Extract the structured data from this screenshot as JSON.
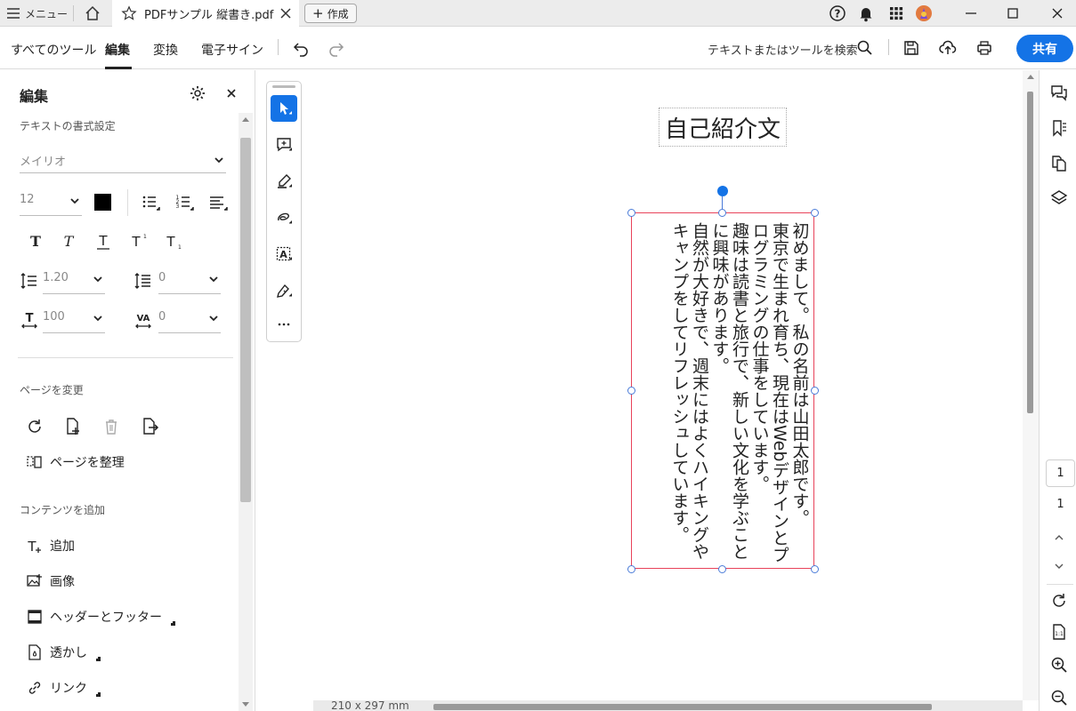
{
  "titlebar": {
    "menu_label": "メニュー",
    "tab_title": "PDFサンプル 縦書き.pdf",
    "new_label": "作成",
    "avatar_color": "#e27a3f"
  },
  "toolbar": {
    "tabs": [
      "すべてのツール",
      "編集",
      "変換",
      "電子サイン"
    ],
    "active_tab": "編集",
    "search_placeholder": "テキストまたはツールを検索",
    "share_label": "共有",
    "accent_color": "#1473e6"
  },
  "left_panel": {
    "title": "編集",
    "text_format_label": "テキストの書式設定",
    "font_name": "メイリオ",
    "font_size": "12",
    "font_color": "#000000",
    "line_spacing": "1.20",
    "paragraph_spacing": "0",
    "scale": "100",
    "char_spacing": "0",
    "page_change_label": "ページを変更",
    "organize_label": "ページを整理",
    "add_content_label": "コンテンツを追加",
    "add_items": [
      "追加",
      "画像",
      "ヘッダーとフッター",
      "透かし",
      "リンク"
    ]
  },
  "document": {
    "title": "自己紹介文",
    "body": "初めまして。私の名前は山田太郎です。\n東京で生まれ育ち、現在はWebデザインとプ\nログラミングの仕事をしています。\n趣味は読書と旅行で、新しい文化を学ぶこと\nに興味があります。\n自然が大好きで、週末にはよくハイキングや\nキャンプをしてリフレッシュしています。",
    "page_size": "210 x 297 mm"
  },
  "right_rail": {
    "current_page": "1",
    "total_pages": "1"
  }
}
